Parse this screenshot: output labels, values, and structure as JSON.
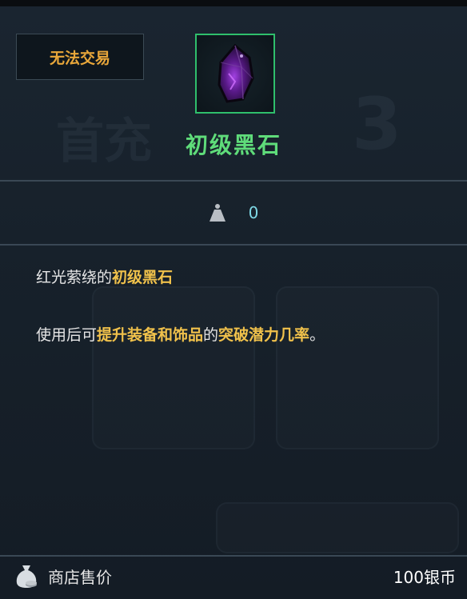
{
  "tooltip": {
    "trade_badge": "无法交易",
    "item_icon": "dark-crystal-icon",
    "item_name": "初级黑石",
    "weight_icon": "weight-icon",
    "weight_value": "0",
    "description": {
      "line1": {
        "prefix": "红光萦绕的",
        "highlight": "初级黑石"
      },
      "line2": {
        "part1": "使用后可",
        "hl1": "提升装备和饰品",
        "part2": "的",
        "hl2": "突破潜力几率",
        "suffix": "。"
      }
    },
    "price": {
      "icon": "money-bag-icon",
      "label": "商店售价",
      "value": "100银币"
    }
  },
  "colors": {
    "item_name": "#5fdc7a",
    "frame_border": "#2fbf6c",
    "badge_text": "#e9a73a",
    "highlight": "#f0c14b",
    "weight_value": "#7fd9e6"
  }
}
